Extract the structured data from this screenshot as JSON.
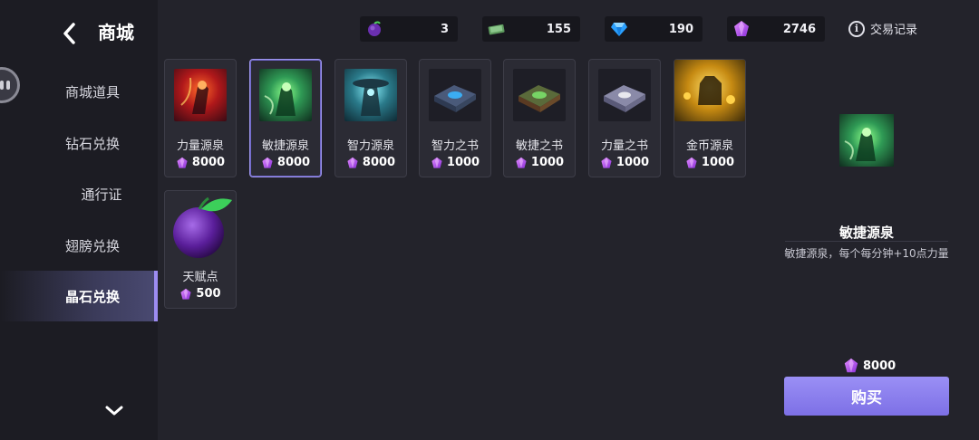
{
  "header": {
    "title": "商城"
  },
  "sidebar": {
    "items": [
      {
        "label": "商城道具"
      },
      {
        "label": "钻石兑换"
      },
      {
        "label": "通行证"
      },
      {
        "label": "翅膀兑换"
      },
      {
        "label": "晶石兑换",
        "active": true
      }
    ]
  },
  "currencies": [
    {
      "icon": "plum-icon",
      "value": "3"
    },
    {
      "icon": "cash-icon",
      "value": "155"
    },
    {
      "icon": "diamond-icon",
      "value": "190"
    },
    {
      "icon": "purple-crystal-icon",
      "value": "2746"
    }
  ],
  "trade_record": {
    "label": "交易记录"
  },
  "items": [
    {
      "name": "力量源泉",
      "price": "8000",
      "icon": "strength-spring-icon"
    },
    {
      "name": "敏捷源泉",
      "price": "8000",
      "icon": "agility-spring-icon",
      "selected": true
    },
    {
      "name": "智力源泉",
      "price": "8000",
      "icon": "intellect-spring-icon"
    },
    {
      "name": "智力之书",
      "price": "1000",
      "icon": "intellect-book-icon"
    },
    {
      "name": "敏捷之书",
      "price": "1000",
      "icon": "agility-book-icon"
    },
    {
      "name": "力量之书",
      "price": "1000",
      "icon": "strength-book-icon"
    },
    {
      "name": "金币源泉",
      "price": "1000",
      "icon": "gold-spring-icon"
    },
    {
      "name": "天赋点",
      "price": "500",
      "icon": "talent-plum-icon"
    }
  ],
  "detail": {
    "name": "敏捷源泉",
    "description": "敏捷源泉，每个每分钟+10点力量",
    "price": "8000",
    "buy_label": "购买"
  },
  "colors": {
    "accent": "#8f84ef",
    "background": "#23232b",
    "sidebar": "#1c1c23",
    "gem": "#b04cf0"
  }
}
